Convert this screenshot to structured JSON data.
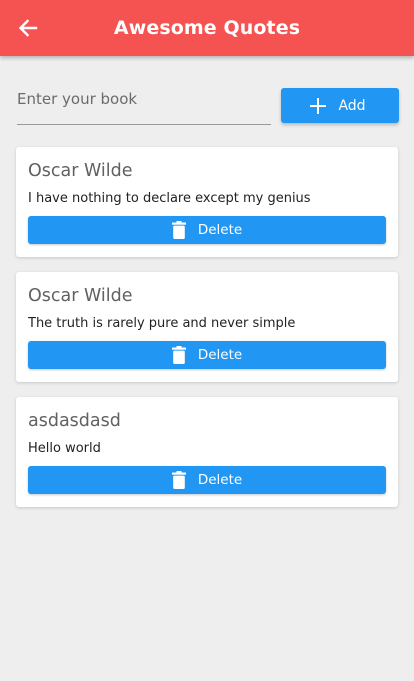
{
  "appbar": {
    "title": "Awesome Quotes",
    "back_icon": "arrow-left-icon",
    "color": "#f55252"
  },
  "form": {
    "placeholder": "Enter your book",
    "value": "",
    "add_label": "Add",
    "add_icon": "plus-icon"
  },
  "quotes": [
    {
      "author": "Oscar Wilde",
      "text": "I have nothing to declare except my genius",
      "delete_label": "Delete"
    },
    {
      "author": "Oscar Wilde",
      "text": "The truth is rarely pure and never simple",
      "delete_label": "Delete"
    },
    {
      "author": "asdasdasd",
      "text": "Hello world",
      "delete_label": "Delete"
    }
  ],
  "colors": {
    "accent": "#2196f3",
    "background": "#eeeeee"
  },
  "delete_icon": "trash-icon"
}
